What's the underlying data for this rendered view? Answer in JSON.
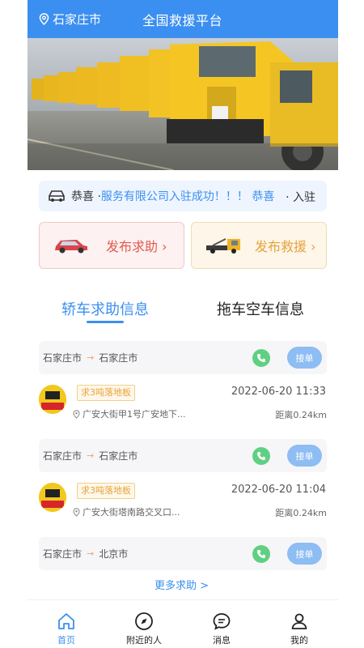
{
  "header": {
    "location": "石家庄市",
    "title": "全国救援平台",
    "location_icon": "location-pin-icon"
  },
  "banner": {
    "alt": "rescue-trucks-banner"
  },
  "notice": {
    "part1": "恭喜 · ",
    "part2": "服务有限公司入驻成功！！！ 恭喜",
    "part3": "· 入驻",
    "icon": "car-icon"
  },
  "actions": {
    "help_label": "发布求助",
    "rescue_label": "发布救援",
    "chevron": "›"
  },
  "tabs": [
    {
      "label": "轿车求助信息",
      "active": true
    },
    {
      "label": "拖车空车信息",
      "active": false
    }
  ],
  "list": [
    {
      "from": "石家庄市",
      "to": "石家庄市",
      "take_label": "接单",
      "tag": "求3吨落地板",
      "time": "2022-06-20 11:33",
      "address": "广安大街甲1号广安地下...",
      "distance": "距离0.24km"
    },
    {
      "from": "石家庄市",
      "to": "石家庄市",
      "take_label": "接单",
      "tag": "求3吨落地板",
      "time": "2022-06-20 11:04",
      "address": "广安大街塔南路交叉口...",
      "distance": "距离0.24km"
    },
    {
      "from": "石家庄市",
      "to": "北京市",
      "take_label": "接单"
    }
  ],
  "more_label": "更多求助 >",
  "bottom_nav": [
    {
      "label": "首页",
      "icon": "home-icon",
      "active": true
    },
    {
      "label": "附近的人",
      "icon": "compass-icon",
      "active": false
    },
    {
      "label": "消息",
      "icon": "message-icon",
      "active": false
    },
    {
      "label": "我的",
      "icon": "user-icon",
      "active": false
    }
  ],
  "colors": {
    "primary": "#3b8ff0",
    "help": "#e25b4d",
    "rescue": "#e6a23c",
    "phone": "#5fd082"
  }
}
